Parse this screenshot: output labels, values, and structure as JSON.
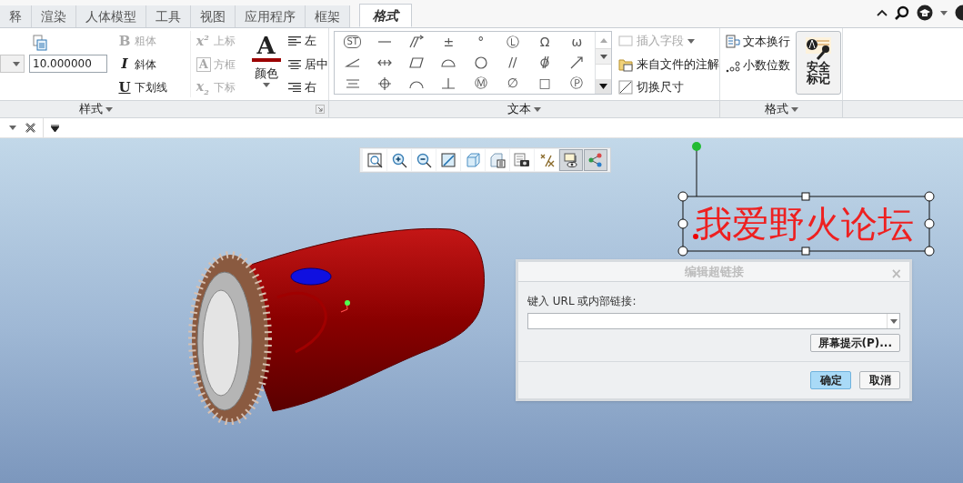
{
  "ribbon_tabs": [
    {
      "label": "释",
      "selected": false
    },
    {
      "label": "渲染",
      "selected": false
    },
    {
      "label": "人体模型",
      "selected": false
    },
    {
      "label": "工具",
      "selected": false
    },
    {
      "label": "视图",
      "selected": false
    },
    {
      "label": "应用程序",
      "selected": false
    },
    {
      "label": "框架",
      "selected": false
    },
    {
      "label": "格式",
      "selected": true
    }
  ],
  "style_group": {
    "label": "样式",
    "height_value": "10.000000",
    "font_buttons": [
      {
        "kind": "bold",
        "glyph": "B",
        "label": "粗体",
        "disabled": true
      },
      {
        "kind": "italic",
        "glyph": "I",
        "label": "斜体",
        "disabled": false
      },
      {
        "kind": "underline",
        "glyph": "U",
        "label": "下划线",
        "disabled": false
      }
    ],
    "script_buttons": [
      {
        "kind": "sup",
        "glyph": "x",
        "mark": "2",
        "label": "上标",
        "disabled": true
      },
      {
        "kind": "box",
        "glyph": "A",
        "label": "方框",
        "disabled": true
      },
      {
        "kind": "sub",
        "glyph": "x",
        "mark": "2",
        "label": "下标",
        "disabled": true
      }
    ],
    "color_button": {
      "glyph": "A",
      "label": "颜色"
    },
    "align_buttons": [
      {
        "kind": "left",
        "label": "左"
      },
      {
        "kind": "center",
        "label": "居中"
      },
      {
        "kind": "right",
        "label": "右"
      }
    ]
  },
  "text_group": {
    "label": "文本",
    "symbols": [
      {
        "kind": "st",
        "text": "ST"
      },
      {
        "kind": "line"
      },
      {
        "kind": "arrows"
      },
      {
        "kind": "glyph",
        "text": "±"
      },
      {
        "kind": "glyph",
        "text": "°"
      },
      {
        "kind": "glyph",
        "text": "Ⓛ"
      },
      {
        "kind": "glyph",
        "text": "Ω"
      },
      {
        "kind": "glyph",
        "text": "ω"
      },
      {
        "kind": "angle"
      },
      {
        "kind": "doublearrow"
      },
      {
        "kind": "parallelogram"
      },
      {
        "kind": "semicircle"
      },
      {
        "kind": "circle"
      },
      {
        "kind": "glyph",
        "text": "//"
      },
      {
        "kind": "cylindricity"
      },
      {
        "kind": "slasharrow"
      },
      {
        "kind": "symmetry"
      },
      {
        "kind": "target"
      },
      {
        "kind": "arc"
      },
      {
        "kind": "perpendicular"
      },
      {
        "kind": "glyph",
        "text": "Ⓜ"
      },
      {
        "kind": "glyph",
        "text": "∅"
      },
      {
        "kind": "glyph",
        "text": "□"
      },
      {
        "kind": "glyph",
        "text": "Ⓟ"
      }
    ],
    "commands": [
      {
        "kind": "field",
        "label": "插入字段",
        "disabled": true
      },
      {
        "kind": "file",
        "label": "来自文件的注解",
        "disabled": false
      },
      {
        "kind": "toggle",
        "label": "切换尺寸",
        "disabled": false
      }
    ]
  },
  "format_group": {
    "label": "格式",
    "commands": [
      {
        "kind": "wrap",
        "label": "文本换行"
      },
      {
        "kind": "decimal",
        "label": "小数位数"
      }
    ],
    "big_button": {
      "label": "安全标记"
    }
  },
  "view_toolbar": [
    {
      "kind": "refit",
      "pressed": false
    },
    {
      "kind": "zoomin",
      "pressed": false
    },
    {
      "kind": "zoomout",
      "pressed": false
    },
    {
      "kind": "reorient",
      "pressed": false
    },
    {
      "kind": "views",
      "pressed": false
    },
    {
      "kind": "viewmgr",
      "pressed": false
    },
    {
      "kind": "capture",
      "pressed": false
    },
    {
      "kind": "datum",
      "pressed": false
    },
    {
      "kind": "annotation",
      "pressed": true
    },
    {
      "kind": "network",
      "pressed": true
    }
  ],
  "annotation": {
    "text": "我爱野火论坛",
    "selected": true
  },
  "dialog": {
    "title": "编辑超链接",
    "close": "×",
    "prompt": "键入 URL 或内部链接:",
    "tip_button": "屏幕提示(P)...",
    "buttons": [
      {
        "label": "确定",
        "default": true
      },
      {
        "label": "取消",
        "default": false
      }
    ]
  }
}
